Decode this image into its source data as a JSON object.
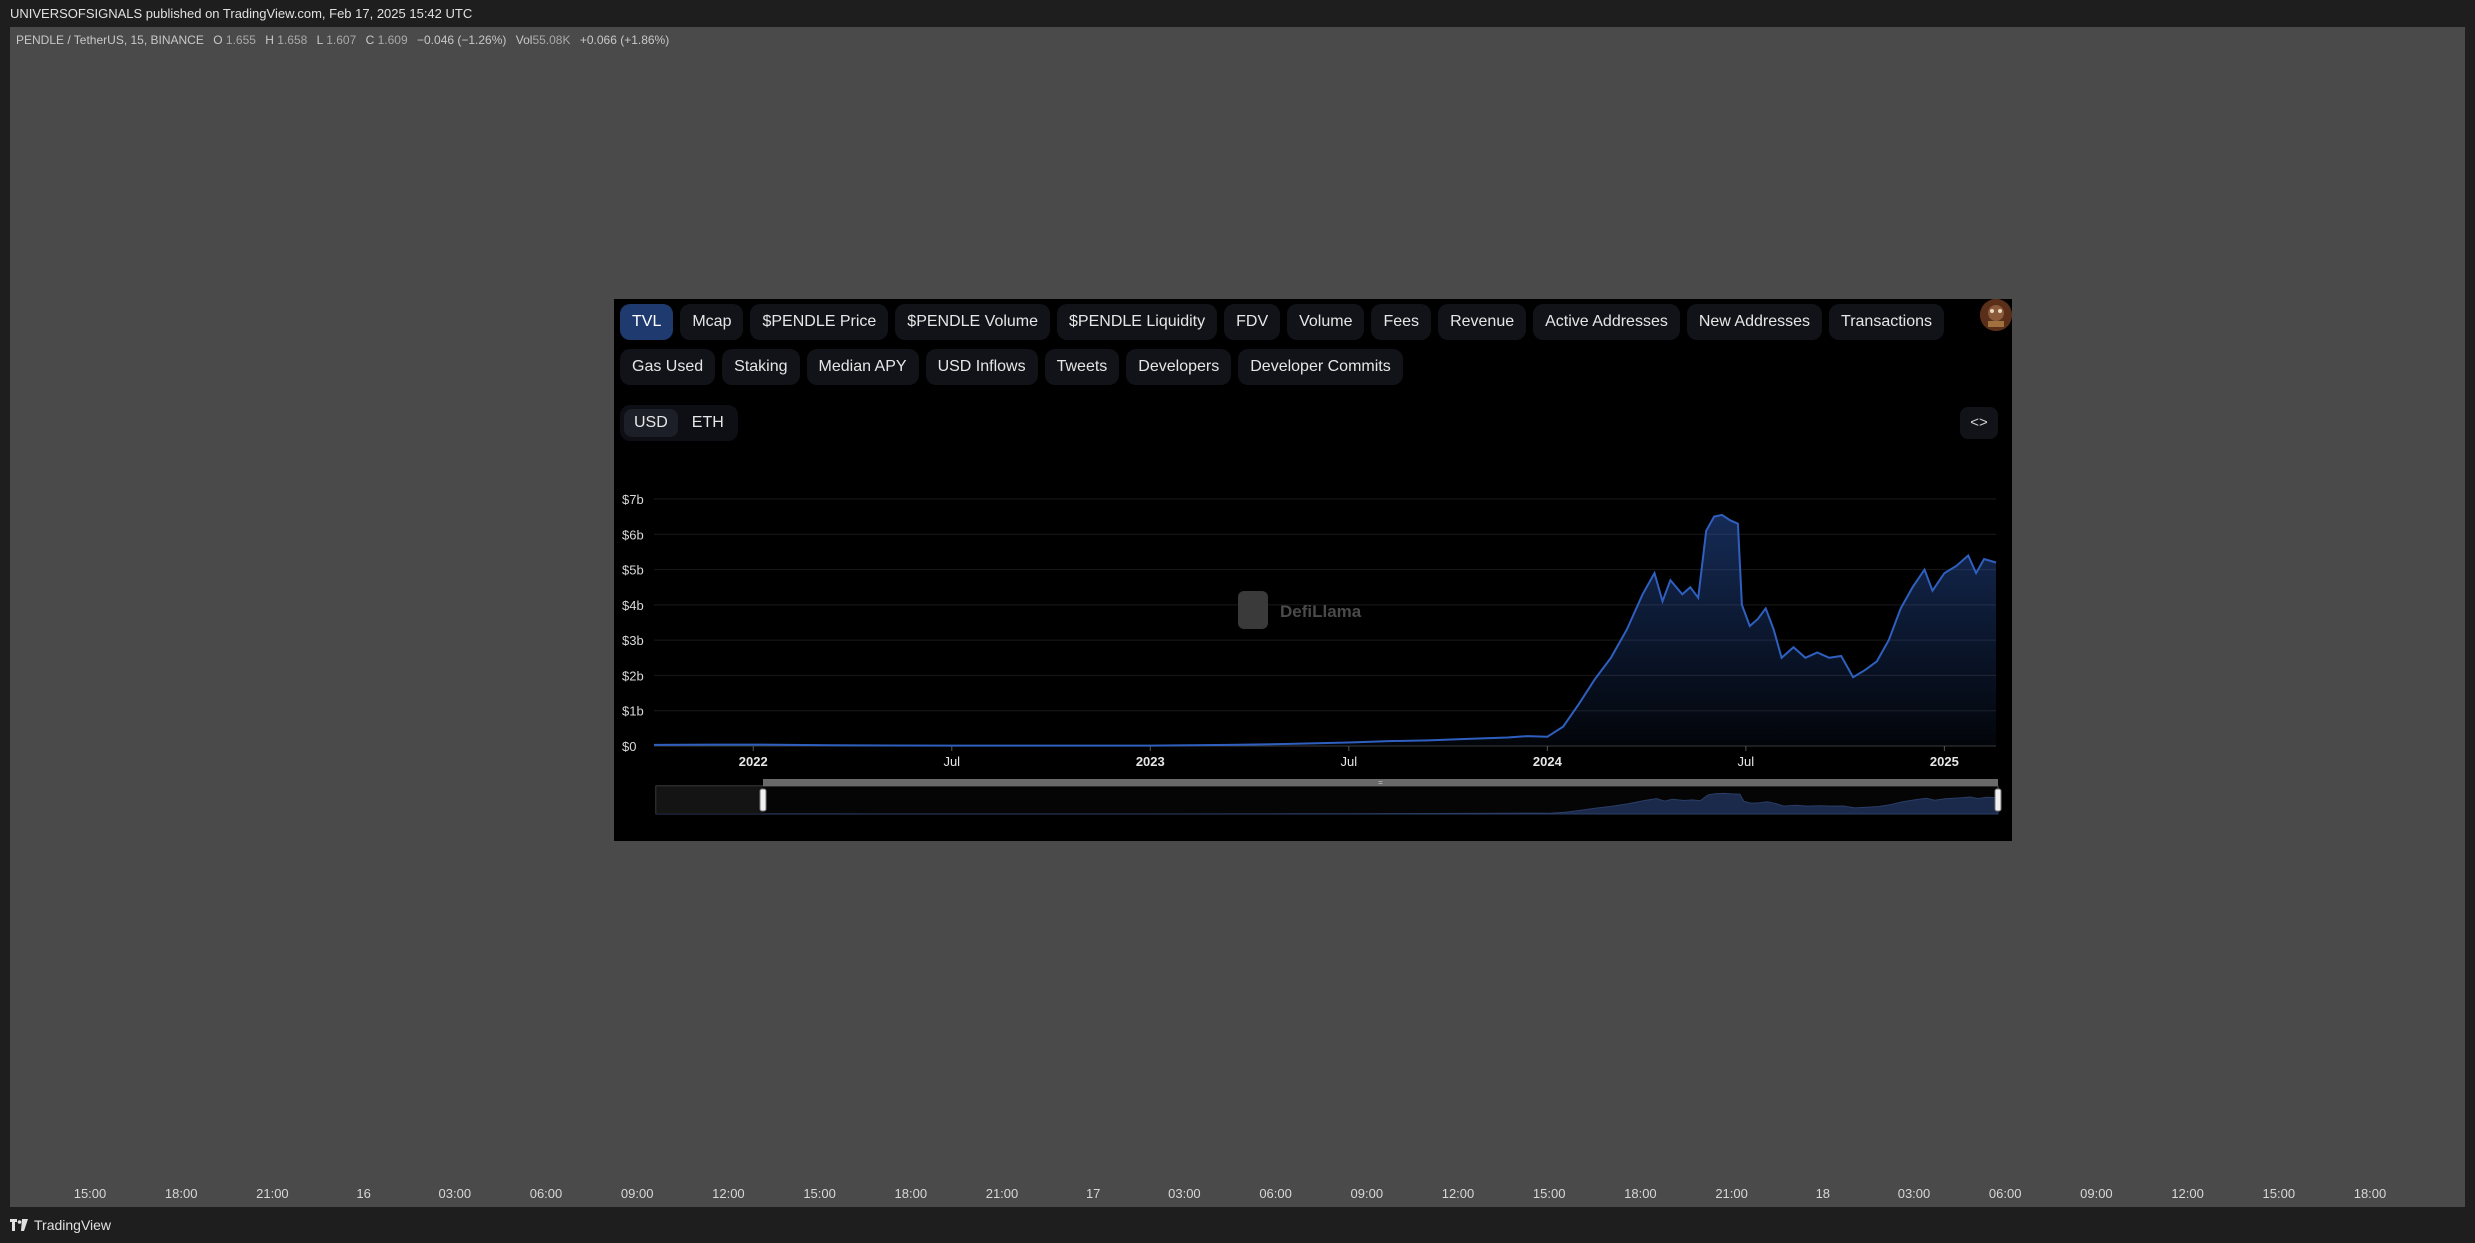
{
  "header": {
    "publish_line": "UNIVERSOFSIGNALS published on TradingView.com, Feb 17, 2025 15:42 UTC"
  },
  "legend": {
    "symbol": "PENDLE / TetherUS, 15, BINANCE",
    "o_label": "O",
    "o_val": "1.655",
    "h_label": "H",
    "h_val": "1.658",
    "l_label": "L",
    "l_val": "1.607",
    "c_label": "C",
    "c_val": "1.609",
    "change": "−0.046 (−1.26%)",
    "vol_label": "Vol",
    "vol_val": "55.08K",
    "vol_change": "+0.066 (+1.86%)"
  },
  "time_axis": [
    "15:00",
    "18:00",
    "21:00",
    "16",
    "03:00",
    "06:00",
    "09:00",
    "12:00",
    "15:00",
    "18:00",
    "21:00",
    "17",
    "03:00",
    "06:00",
    "09:00",
    "12:00",
    "15:00",
    "18:00",
    "21:00",
    "18",
    "03:00",
    "06:00",
    "09:00",
    "12:00",
    "15:00",
    "18:00"
  ],
  "footer": {
    "brand": "TradingView"
  },
  "defillama": {
    "tabs_row1": [
      "TVL",
      "Mcap",
      "$PENDLE Price",
      "$PENDLE Volume",
      "$PENDLE Liquidity",
      "FDV",
      "Volume",
      "Fees",
      "Revenue",
      "Active Addresses",
      "New Addresses",
      "Transactions"
    ],
    "tabs_row2": [
      "Gas Used",
      "Staking",
      "Median APY",
      "USD Inflows",
      "Tweets",
      "Developers",
      "Developer Commits"
    ],
    "active_tab": "TVL",
    "currency_options": [
      "USD",
      "ETH"
    ],
    "active_currency": "USD",
    "embed_icon": "code-brackets-icon",
    "watermark": "DefiLlama",
    "accent_color": "#2f5fbf",
    "active_tab_color": "#1f3a6e"
  },
  "chart_data": {
    "type": "area",
    "ylabel": "",
    "xlabel": "",
    "y_ticks": [
      "$0",
      "$1b",
      "$2b",
      "$3b",
      "$4b",
      "$5b",
      "$6b",
      "$7b"
    ],
    "x_ticks": [
      {
        "label": "2022",
        "t": 2022.0,
        "bold": true
      },
      {
        "label": "Jul",
        "t": 2022.5,
        "bold": false
      },
      {
        "label": "2023",
        "t": 2023.0,
        "bold": true
      },
      {
        "label": "Jul",
        "t": 2023.5,
        "bold": false
      },
      {
        "label": "2024",
        "t": 2024.0,
        "bold": true
      },
      {
        "label": "Jul",
        "t": 2024.5,
        "bold": false
      },
      {
        "label": "2025",
        "t": 2025.0,
        "bold": true
      }
    ],
    "ylim": [
      0,
      7
    ],
    "xlim": [
      2021.75,
      2025.13
    ],
    "unit": "billion USD",
    "series": [
      {
        "points": [
          [
            2021.75,
            0.03
          ],
          [
            2021.9,
            0.04
          ],
          [
            2022.0,
            0.04
          ],
          [
            2022.2,
            0.02
          ],
          [
            2022.5,
            0.01
          ],
          [
            2022.8,
            0.01
          ],
          [
            2023.0,
            0.01
          ],
          [
            2023.2,
            0.03
          ],
          [
            2023.35,
            0.06
          ],
          [
            2023.5,
            0.1
          ],
          [
            2023.6,
            0.14
          ],
          [
            2023.7,
            0.16
          ],
          [
            2023.8,
            0.2
          ],
          [
            2023.9,
            0.24
          ],
          [
            2023.95,
            0.28
          ],
          [
            2024.0,
            0.26
          ],
          [
            2024.04,
            0.55
          ],
          [
            2024.08,
            1.2
          ],
          [
            2024.12,
            1.9
          ],
          [
            2024.16,
            2.5
          ],
          [
            2024.2,
            3.3
          ],
          [
            2024.24,
            4.3
          ],
          [
            2024.27,
            4.9
          ],
          [
            2024.29,
            4.1
          ],
          [
            2024.31,
            4.7
          ],
          [
            2024.34,
            4.3
          ],
          [
            2024.36,
            4.5
          ],
          [
            2024.38,
            4.2
          ],
          [
            2024.4,
            6.1
          ],
          [
            2024.42,
            6.5
          ],
          [
            2024.44,
            6.55
          ],
          [
            2024.46,
            6.4
          ],
          [
            2024.48,
            6.3
          ],
          [
            2024.49,
            4.0
          ],
          [
            2024.51,
            3.4
          ],
          [
            2024.53,
            3.6
          ],
          [
            2024.55,
            3.9
          ],
          [
            2024.57,
            3.3
          ],
          [
            2024.59,
            2.5
          ],
          [
            2024.62,
            2.8
          ],
          [
            2024.65,
            2.5
          ],
          [
            2024.68,
            2.65
          ],
          [
            2024.71,
            2.5
          ],
          [
            2024.74,
            2.55
          ],
          [
            2024.77,
            1.95
          ],
          [
            2024.8,
            2.15
          ],
          [
            2024.83,
            2.4
          ],
          [
            2024.86,
            3.0
          ],
          [
            2024.89,
            3.9
          ],
          [
            2024.92,
            4.5
          ],
          [
            2024.95,
            5.0
          ],
          [
            2024.97,
            4.4
          ],
          [
            2025.0,
            4.9
          ],
          [
            2025.03,
            5.1
          ],
          [
            2025.06,
            5.4
          ],
          [
            2025.08,
            4.9
          ],
          [
            2025.1,
            5.3
          ],
          [
            2025.13,
            5.2
          ]
        ]
      }
    ]
  }
}
